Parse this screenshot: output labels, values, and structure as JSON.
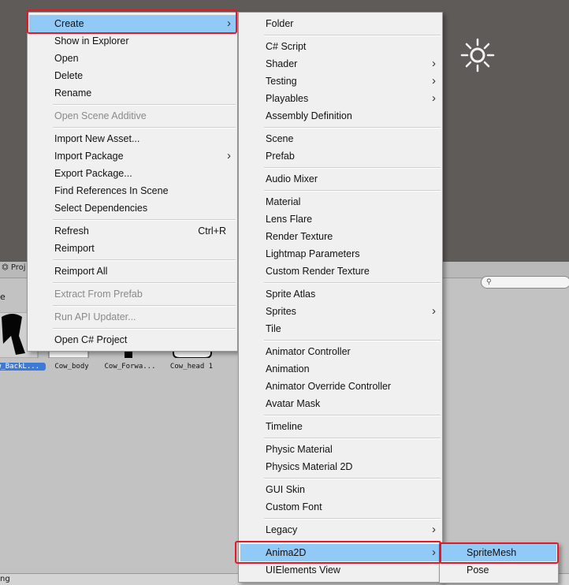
{
  "scene": {
    "sun_icon": "directional-light-sun-icon"
  },
  "project_panel": {
    "tab_label": "Proj",
    "search_placeholder": "",
    "breadcrumb": "e",
    "assets": [
      {
        "label": "w_BackL..."
      },
      {
        "label": "Cow_body"
      },
      {
        "label": "Cow_Forwa..."
      },
      {
        "label": "Cow_head 1"
      }
    ],
    "status_text": "ng"
  },
  "context_menu": {
    "items": [
      {
        "label": "Create",
        "submenu": true
      },
      {
        "label": "Show in Explorer"
      },
      {
        "label": "Open"
      },
      {
        "label": "Delete"
      },
      {
        "label": "Rename"
      },
      {
        "label": "Open Scene Additive",
        "disabled": true
      },
      {
        "label": "Import New Asset..."
      },
      {
        "label": "Import Package",
        "submenu": true
      },
      {
        "label": "Export Package..."
      },
      {
        "label": "Find References In Scene"
      },
      {
        "label": "Select Dependencies"
      },
      {
        "label": "Refresh",
        "shortcut": "Ctrl+R"
      },
      {
        "label": "Reimport"
      },
      {
        "label": "Reimport All"
      },
      {
        "label": "Extract From Prefab",
        "disabled": true
      },
      {
        "label": "Run API Updater...",
        "disabled": true
      },
      {
        "label": "Open C# Project"
      }
    ]
  },
  "create_submenu": {
    "items": [
      {
        "label": "Folder"
      },
      {
        "label": "C# Script"
      },
      {
        "label": "Shader",
        "submenu": true
      },
      {
        "label": "Testing",
        "submenu": true
      },
      {
        "label": "Playables",
        "submenu": true
      },
      {
        "label": "Assembly Definition"
      },
      {
        "label": "Scene"
      },
      {
        "label": "Prefab"
      },
      {
        "label": "Audio Mixer"
      },
      {
        "label": "Material"
      },
      {
        "label": "Lens Flare"
      },
      {
        "label": "Render Texture"
      },
      {
        "label": "Lightmap Parameters"
      },
      {
        "label": "Custom Render Texture"
      },
      {
        "label": "Sprite Atlas"
      },
      {
        "label": "Sprites",
        "submenu": true
      },
      {
        "label": "Tile"
      },
      {
        "label": "Animator Controller"
      },
      {
        "label": "Animation"
      },
      {
        "label": "Animator Override Controller"
      },
      {
        "label": "Avatar Mask"
      },
      {
        "label": "Timeline"
      },
      {
        "label": "Physic Material"
      },
      {
        "label": "Physics Material 2D"
      },
      {
        "label": "GUI Skin"
      },
      {
        "label": "Custom Font"
      },
      {
        "label": "Legacy",
        "submenu": true
      },
      {
        "label": "Anima2D",
        "submenu": true
      },
      {
        "label": "UIElements View"
      }
    ]
  },
  "anima2d_submenu": {
    "items": [
      {
        "label": "SpriteMesh"
      },
      {
        "label": "Pose"
      }
    ]
  },
  "colors": {
    "highlight": "#91c9f7",
    "annotation_red": "#e3192a"
  }
}
